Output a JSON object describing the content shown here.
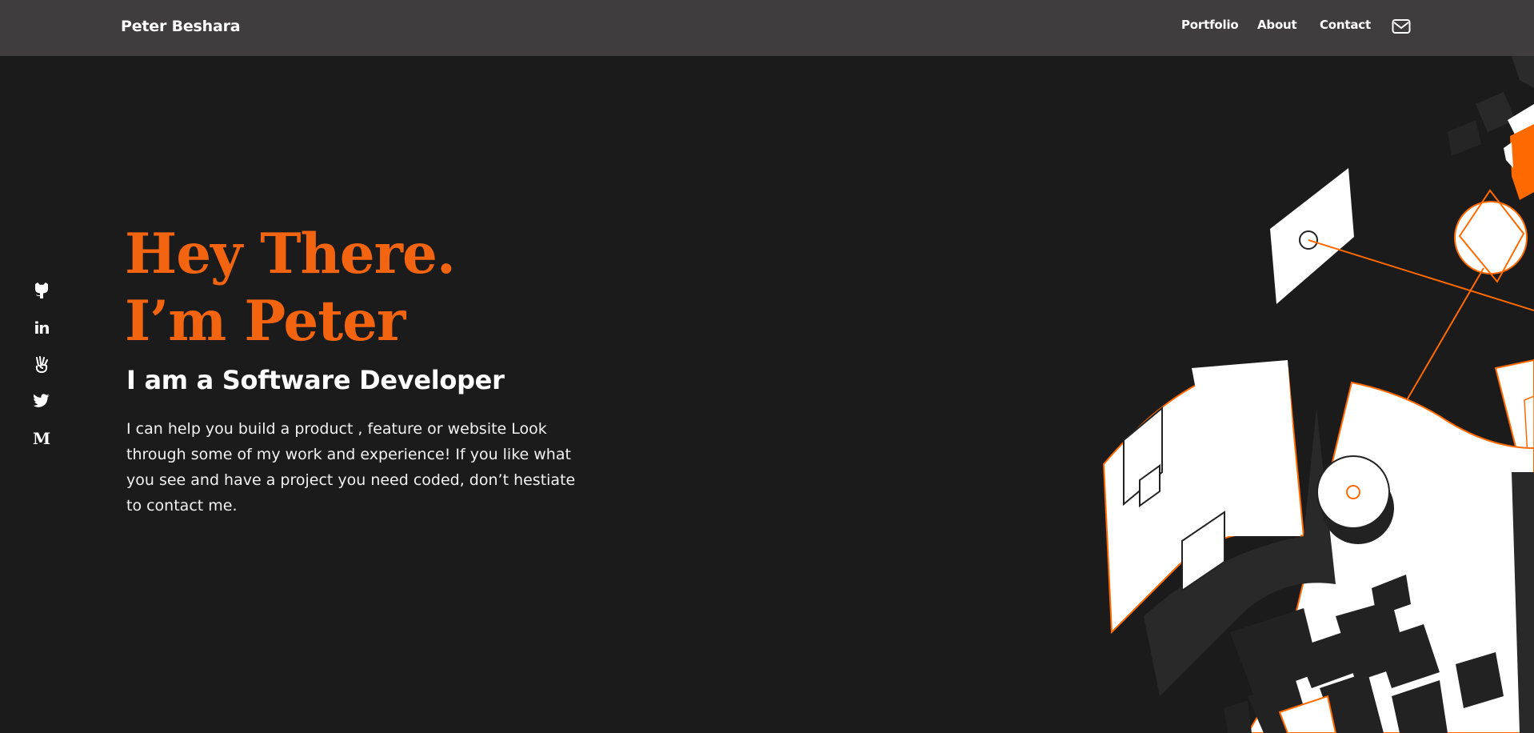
{
  "header": {
    "brand": "Peter Beshara",
    "nav": [
      {
        "label": "Portfolio"
      },
      {
        "label": "About"
      },
      {
        "label": "Contact"
      }
    ],
    "mail_icon": "mail-icon"
  },
  "social": [
    {
      "name": "github",
      "icon": "github-icon"
    },
    {
      "name": "linkedin",
      "icon": "linkedin-icon",
      "text": "in"
    },
    {
      "name": "angellist",
      "icon": "angellist-icon"
    },
    {
      "name": "twitter",
      "icon": "twitter-icon"
    },
    {
      "name": "medium",
      "icon": "medium-icon",
      "text": "M"
    }
  ],
  "hero": {
    "line1": "Hey There.",
    "line2": "I’m Peter",
    "subtitle": "I am a Software Developer",
    "description": "I can help you build a product , feature or website Look through some of my work and experience! If you like what you see and have a project you need coded, don’t hestiate to contact me."
  },
  "colors": {
    "background": "#1c1b1b",
    "header": "#3f3d3e",
    "accent": "#f26410"
  }
}
